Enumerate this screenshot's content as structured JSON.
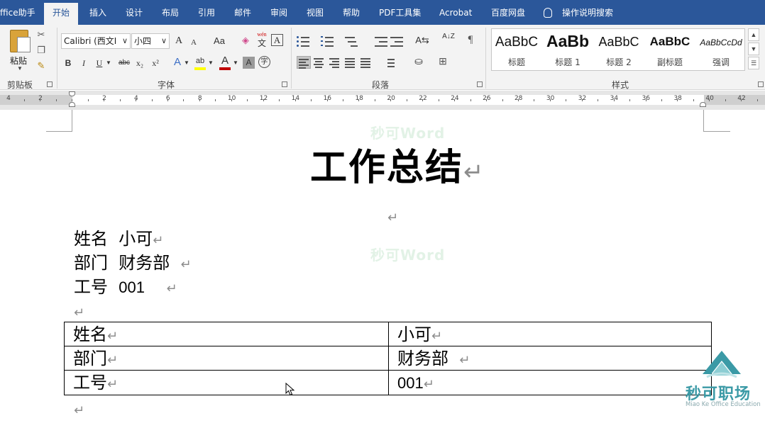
{
  "tabs": {
    "office_helper": "ffice助手",
    "home": "开始",
    "insert": "插入",
    "design": "设计",
    "layout": "布局",
    "references": "引用",
    "mailings": "邮件",
    "review": "审阅",
    "view": "视图",
    "help": "帮助",
    "pdf_tools": "PDF工具集",
    "acrobat": "Acrobat",
    "baidu_drive": "百度网盘",
    "tell_me": "操作说明搜索"
  },
  "ribbon": {
    "clipboard": {
      "paste_label": "粘贴",
      "group_label": "剪贴板"
    },
    "font": {
      "font_name": "Calibri (西文I",
      "font_size": "小四",
      "grow": "A",
      "shrink": "A",
      "change_case": "Aa",
      "phonetic_top": "wén",
      "phonetic_bottom": "文",
      "char_border": "A",
      "bold": "B",
      "italic": "I",
      "underline": "U",
      "strike": "abc",
      "subscript": "x₂",
      "superscript": "x²",
      "text_effects": "A",
      "highlight": "ab",
      "font_color": "A",
      "char_shading": "A",
      "enclose": "字",
      "group_label": "字体",
      "font_color_hex": "#c00000",
      "highlight_hex": "#ffff00"
    },
    "paragraph": {
      "group_label": "段落",
      "sort_label": "A↓Z"
    },
    "styles": {
      "group_label": "样式",
      "items": [
        {
          "sample": "AaBbC",
          "name": "标题"
        },
        {
          "sample": "AaBb",
          "name": "标题 1"
        },
        {
          "sample": "AaBbC",
          "name": "标题 2"
        },
        {
          "sample": "AaBbC",
          "name": "副标题"
        },
        {
          "sample": "AaBbCcDd",
          "name": "强调"
        }
      ]
    }
  },
  "ruler": {
    "labels": [
      "4",
      "2",
      "2",
      "4",
      "6",
      "8",
      "10",
      "12",
      "14",
      "16",
      "18",
      "20",
      "22",
      "24",
      "26",
      "28",
      "30",
      "32",
      "34",
      "36",
      "38",
      "40",
      "42"
    ]
  },
  "document": {
    "watermark": "秒可Word",
    "title": "工作总结",
    "return_mark": "↵",
    "info_lines": [
      {
        "label": "姓名",
        "value": "小可"
      },
      {
        "label": "部门",
        "value": "财务部"
      },
      {
        "label": "工号",
        "value": "001"
      }
    ],
    "table_rows": [
      {
        "label": "姓名",
        "value": "小可"
      },
      {
        "label": "部门",
        "value": "财务部"
      },
      {
        "label": "工号",
        "value": "001"
      }
    ]
  },
  "branding": {
    "name": "秒可职场",
    "subtitle": "Miao Ke Office Education",
    "logo_color": "#3b9aa6"
  }
}
